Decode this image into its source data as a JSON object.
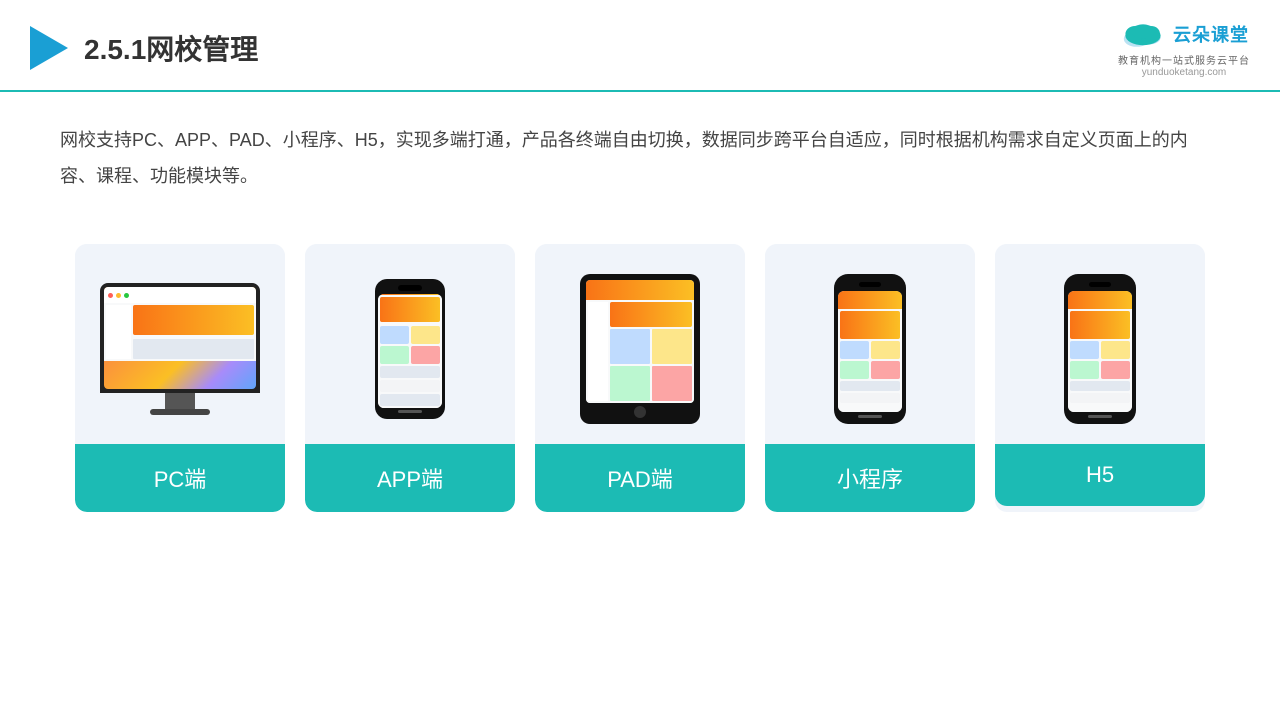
{
  "header": {
    "title": "2.5.1网校管理",
    "logo_name": "云朵课堂",
    "logo_url": "yunduoketang.com",
    "logo_tagline": "教育机构一站式服务云平台"
  },
  "description": {
    "text": "网校支持PC、APP、PAD、小程序、H5，实现多端打通，产品各终端自由切换，数据同步跨平台自适应，同时根据机构需求自定义页面上的内容、课程、功能模块等。"
  },
  "cards": [
    {
      "id": "pc",
      "label": "PC端"
    },
    {
      "id": "app",
      "label": "APP端"
    },
    {
      "id": "pad",
      "label": "PAD端"
    },
    {
      "id": "miniprogram",
      "label": "小程序"
    },
    {
      "id": "h5",
      "label": "H5"
    }
  ]
}
